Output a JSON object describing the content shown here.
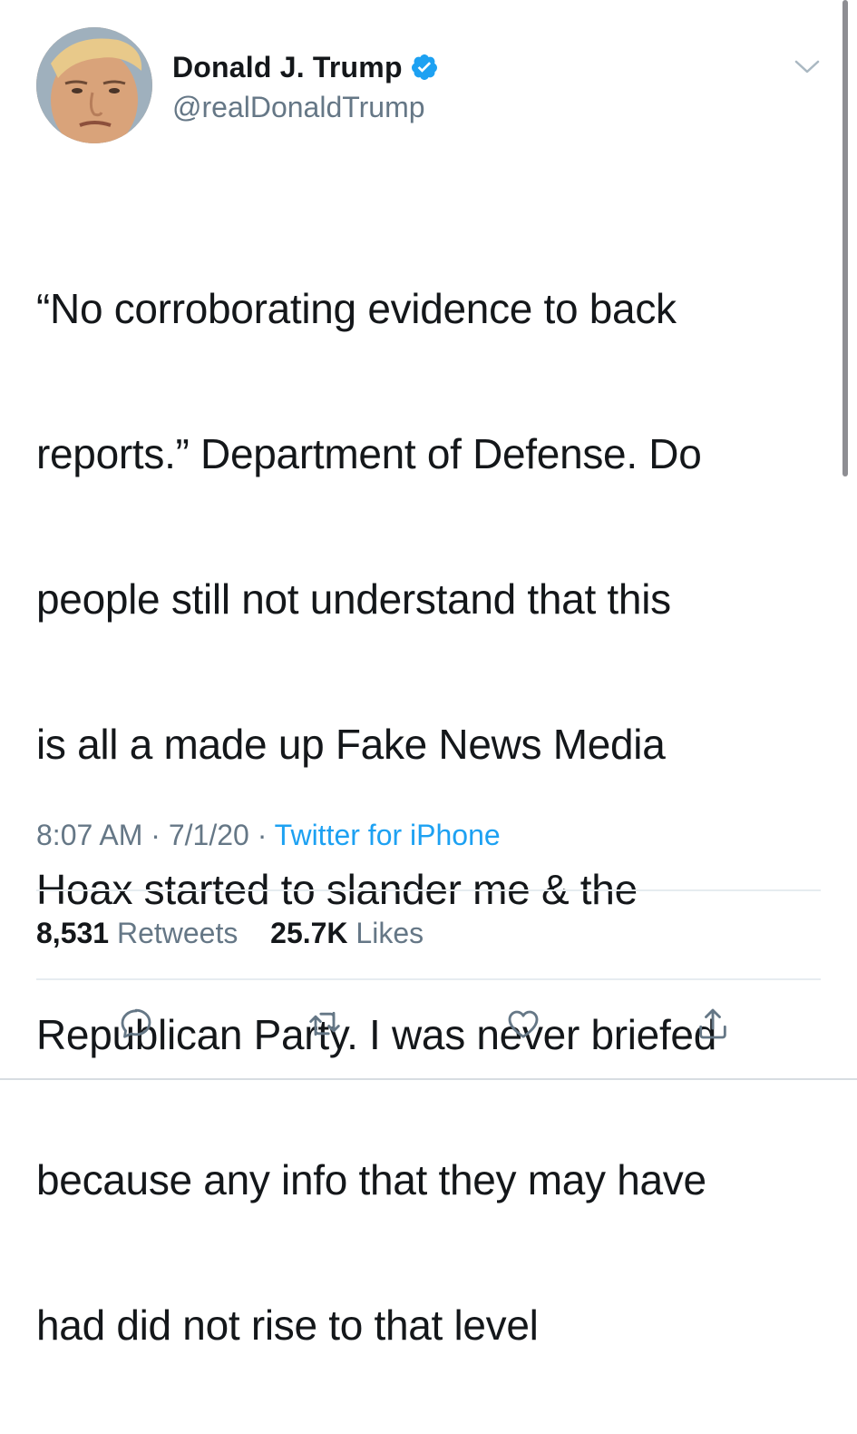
{
  "author": {
    "display_name": "Donald J. Trump",
    "handle": "@realDonaldTrump",
    "verified": true
  },
  "tweet": {
    "text_lines": [
      "“No corroborating evidence to back",
      "reports.” Department of Defense. Do",
      "people still not understand that this",
      "is all a made up Fake News Media",
      "Hoax started to slander me & the",
      "Republican Party. I was never briefed",
      "because any info that they may have",
      "had did not rise to that level"
    ]
  },
  "meta": {
    "time": "8:07 AM",
    "separator": "·",
    "date": "7/1/20",
    "source": "Twitter for iPhone"
  },
  "stats": {
    "retweets_count": "8,531",
    "retweets_label": "Retweets",
    "likes_count": "25.7K",
    "likes_label": "Likes"
  },
  "icons": {
    "reply": "reply-icon",
    "retweet": "retweet-icon",
    "like": "heart-icon",
    "share": "share-icon",
    "verified": "verified-badge-icon",
    "more": "chevron-down-icon"
  },
  "colors": {
    "text": "#14171a",
    "secondary": "#657786",
    "link": "#1da1f2",
    "verified": "#1da1f2",
    "divider": "#e6ecf0"
  }
}
